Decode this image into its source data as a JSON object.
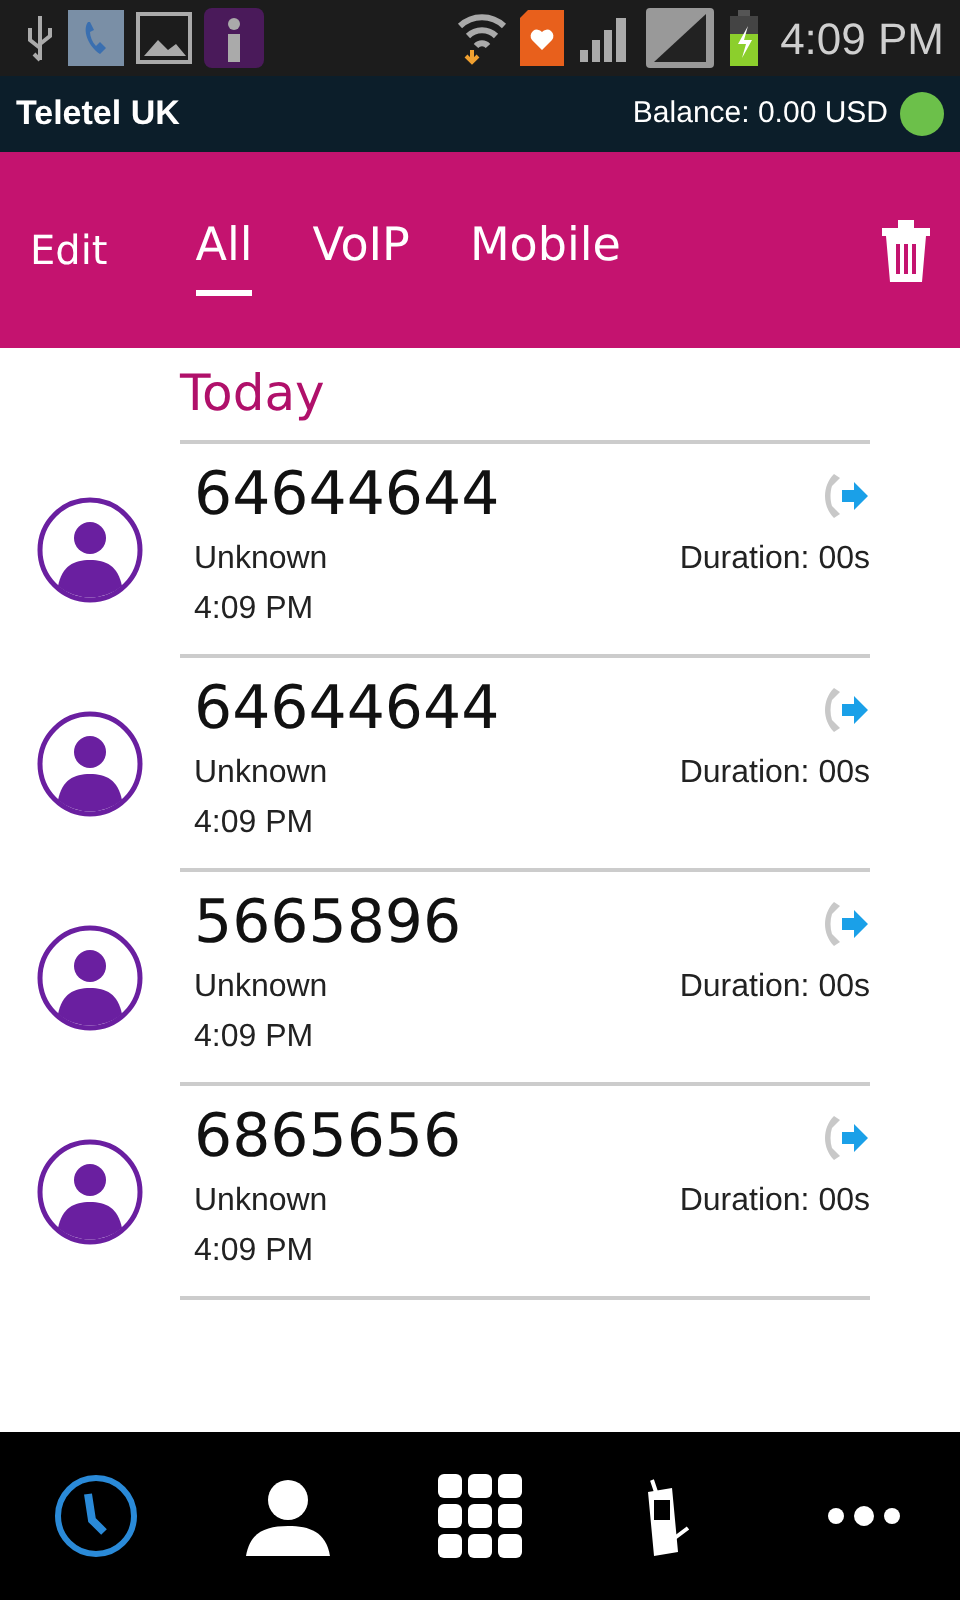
{
  "status_bar": {
    "time": "4:09 PM"
  },
  "app_bar": {
    "title": "Teletel UK",
    "balance": "Balance: 0.00 USD",
    "online": true
  },
  "toolbar": {
    "edit": "Edit",
    "tabs": [
      {
        "label": "All",
        "selected": true
      },
      {
        "label": "VoIP",
        "selected": false
      },
      {
        "label": "Mobile",
        "selected": false
      }
    ]
  },
  "section": "Today",
  "calls": [
    {
      "number": "64644644",
      "name": "Unknown",
      "time": "4:09 PM",
      "duration": "Duration: 00s"
    },
    {
      "number": "64644644",
      "name": "Unknown",
      "time": "4:09 PM",
      "duration": "Duration: 00s"
    },
    {
      "number": "5665896",
      "name": "Unknown",
      "time": "4:09 PM",
      "duration": "Duration: 00s"
    },
    {
      "number": "6865656",
      "name": "Unknown",
      "time": "4:09 PM",
      "duration": "Duration: 00s"
    }
  ],
  "bottom_nav": [
    {
      "kind": "recents",
      "selected": true
    },
    {
      "kind": "contacts",
      "selected": false
    },
    {
      "kind": "dialpad",
      "selected": false
    },
    {
      "kind": "mobile",
      "selected": false
    },
    {
      "kind": "more",
      "selected": false
    }
  ]
}
